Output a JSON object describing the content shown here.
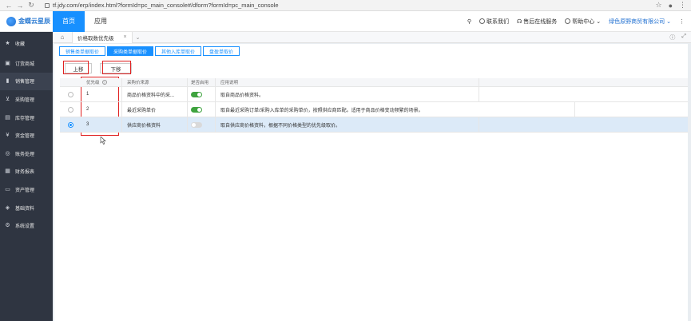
{
  "browser": {
    "url": "tf.jdy.com/erp/index.html?formId=pc_main_console#/dform?formId=pc_main_console"
  },
  "header": {
    "logo_text": "金蝶云星辰",
    "tabs": [
      {
        "label": "首页",
        "active": true
      },
      {
        "label": "应用",
        "active": false
      }
    ],
    "right_items": [
      "联系我们",
      "售后在线服务",
      "帮助中心"
    ],
    "company": "绿色原野商贸有限公司",
    "accent": "#1890ff"
  },
  "sidebar": {
    "items": [
      {
        "label": "收藏",
        "icon": "star-icon"
      },
      {
        "label": "订货商城",
        "icon": "store-icon"
      },
      {
        "label": "销售管理",
        "icon": "bar-chart-icon",
        "active": true
      },
      {
        "label": "采购管理",
        "icon": "cart-icon"
      },
      {
        "label": "库存管理",
        "icon": "box-icon"
      },
      {
        "label": "资金管理",
        "icon": "money-icon"
      },
      {
        "label": "账务处理",
        "icon": "ledger-icon"
      },
      {
        "label": "财务报表",
        "icon": "report-icon"
      },
      {
        "label": "资产管理",
        "icon": "asset-icon"
      },
      {
        "label": "基础资料",
        "icon": "layers-icon"
      },
      {
        "label": "系统设置",
        "icon": "gear-icon"
      }
    ]
  },
  "page_tab": {
    "label": "价格取数优先级"
  },
  "subtabs": [
    {
      "label": "销售类单据取价",
      "active": false
    },
    {
      "label": "采购类单据取价",
      "active": true
    },
    {
      "label": "其他入库单取价",
      "active": false
    },
    {
      "label": "盘盈单取价",
      "active": false
    }
  ],
  "actions": {
    "move_up": "上移",
    "move_down": "下移"
  },
  "table": {
    "headers": {
      "priority": "优先级",
      "source": "采购价来源",
      "enabled": "是否启用",
      "description": "应用说明"
    },
    "rows": [
      {
        "priority": "1",
        "source": "商品价格资料中的采...",
        "enabled": true,
        "description": "取自商品价格资料。",
        "selected": false
      },
      {
        "priority": "2",
        "source": "最近采购单价",
        "enabled": true,
        "description": "取自最近采购订单/采购入库单的采购单价，按照供应商匹配。适用于商品价格变动频繁的场景。",
        "selected": false
      },
      {
        "priority": "3",
        "source": "供应商价格资料",
        "enabled": false,
        "description": "取自供应商价格资料，根据不同价格类型的优先级取价。",
        "selected": true
      }
    ]
  }
}
